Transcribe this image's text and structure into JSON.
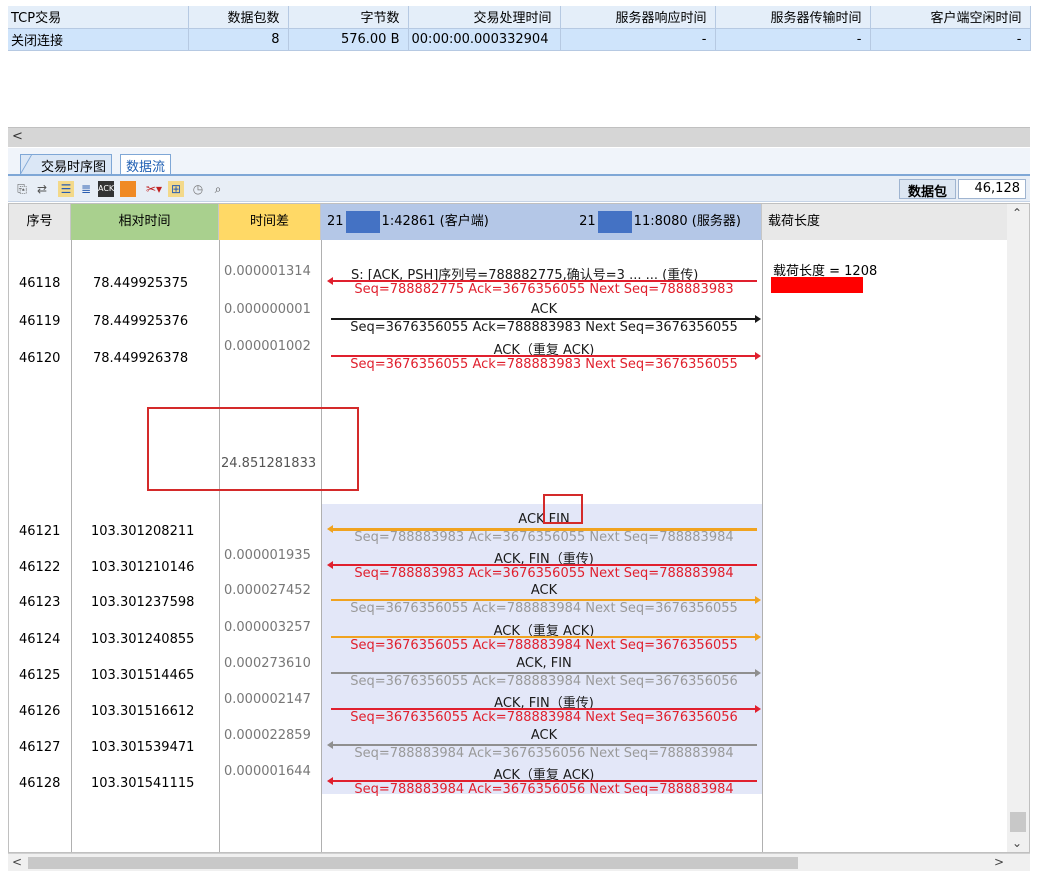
{
  "summary": {
    "headers": [
      "TCP交易",
      "数据包数",
      "字节数",
      "交易处理时间",
      "服务器响应时间",
      "服务器传输时间",
      "客户端空闲时间"
    ],
    "row": [
      "关闭连接",
      "8",
      "576.00 B",
      "00:00:00.000332904",
      "-",
      "-",
      "-"
    ]
  },
  "tabs": {
    "active": "交易时序图",
    "other": "数据流"
  },
  "toolbar": {
    "packets_label": "数据包",
    "packets_value": "46,128"
  },
  "columns": {
    "seq": "序号",
    "rel_time": "相对时间",
    "diff": "时间差",
    "client_prefix": "21",
    "client_suffix": "1:42861 (客户端)",
    "server_prefix": "21",
    "server_suffix": "11:8080 (服务器)",
    "payload_len": "载荷长度"
  },
  "payload_note": "载荷长度 = 1208",
  "gap_diff": "24.851281833",
  "rows": [
    {
      "seq": "46118",
      "rel": "78.449925375",
      "diff": "0.000001314",
      "top": "S: [ACK, PSH]序列号=788882775,确认号=3 ... ... (重传)",
      "bottom": "Seq=788882775  Ack=3676356055  Next Seq=788883983",
      "dir": "left",
      "color": "red"
    },
    {
      "seq": "46119",
      "rel": "78.449925376",
      "diff": "0.000000001",
      "top": "ACK",
      "bottom": "Seq=3676356055  Ack=788883983  Next Seq=3676356055",
      "dir": "right",
      "color": "black"
    },
    {
      "seq": "46120",
      "rel": "78.449926378",
      "diff": "0.000001002",
      "top": "ACK（重复 ACK)",
      "bottom": "Seq=3676356055  Ack=788883983  Next Seq=3676356055",
      "dir": "right",
      "color": "red"
    },
    {
      "seq": "46121",
      "rel": "103.301208211",
      "diff": "",
      "top": "ACK FIN",
      "bottom": "Seq=788883983  Ack=3676356055  Next Seq=788883984",
      "dir": "left",
      "color": "orange"
    },
    {
      "seq": "46122",
      "rel": "103.301210146",
      "diff": "0.000001935",
      "top": "ACK, FIN（重传)",
      "bottom": "Seq=788883983  Ack=3676356055  Next Seq=788883984",
      "dir": "left",
      "color": "red"
    },
    {
      "seq": "46123",
      "rel": "103.301237598",
      "diff": "0.000027452",
      "top": "ACK",
      "bottom": "Seq=3676356055  Ack=788883984  Next Seq=3676356055",
      "dir": "right",
      "color": "orange"
    },
    {
      "seq": "46124",
      "rel": "103.301240855",
      "diff": "0.000003257",
      "top": "ACK（重复 ACK)",
      "bottom": "Seq=3676356055  Ack=788883984  Next Seq=3676356055",
      "dir": "right",
      "color": "redorange"
    },
    {
      "seq": "46125",
      "rel": "103.301514465",
      "diff": "0.000273610",
      "top": "ACK, FIN",
      "bottom": "Seq=3676356055  Ack=788883984  Next Seq=3676356056",
      "dir": "right",
      "color": "grey"
    },
    {
      "seq": "46126",
      "rel": "103.301516612",
      "diff": "0.000002147",
      "top": "ACK, FIN（重传)",
      "bottom": "Seq=3676356055  Ack=788883984  Next Seq=3676356056",
      "dir": "right",
      "color": "red"
    },
    {
      "seq": "46127",
      "rel": "103.301539471",
      "diff": "0.000022859",
      "top": "ACK",
      "bottom": "Seq=788883984  Ack=3676356056  Next Seq=788883984",
      "dir": "left",
      "color": "grey"
    },
    {
      "seq": "46128",
      "rel": "103.301541115",
      "diff": "0.000001644",
      "top": "ACK（重复 ACK)",
      "bottom": "Seq=788883984  Ack=3676356056  Next Seq=788883984",
      "dir": "left",
      "color": "red"
    }
  ]
}
